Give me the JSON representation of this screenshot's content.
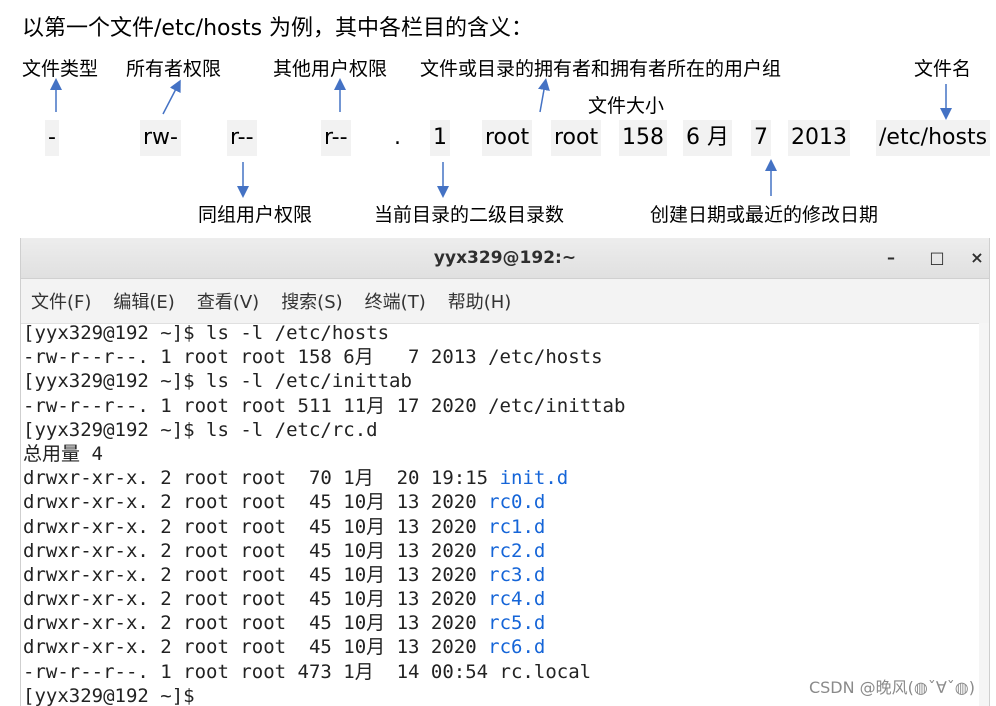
{
  "heading": "以第一个文件/etc/hosts 为例，其中各栏目的含义：",
  "top_labels": {
    "file_type": "文件类型",
    "owner_perm": "所有者权限",
    "other_perm": "其他用户权限",
    "owner_and_group": "文件或目录的拥有者和拥有者所在的用户组",
    "file_name": "文件名",
    "file_size": "文件大小"
  },
  "fields": {
    "type": "-",
    "owner": "rw-",
    "group": "r--",
    "other": "r--",
    "dot": ".",
    "links": "1",
    "user": "root",
    "grp": "root",
    "size": "158",
    "month": "6 月",
    "day": "7",
    "year": "2013",
    "name": "/etc/hosts"
  },
  "bottom_labels": {
    "group_perm": "同组用户权限",
    "subdir_count": "当前目录的二级目录数",
    "date": "创建日期或最近的修改日期"
  },
  "terminal": {
    "title": "yyx329@192:~",
    "minimize": "–",
    "maximize": "□",
    "close": "×",
    "menu": [
      "文件(F)",
      "编辑(E)",
      "查看(V)",
      "搜索(S)",
      "终端(T)",
      "帮助(H)"
    ],
    "lines": [
      {
        "text": "[yyx329@192 ~]$ ls -l /etc/hosts"
      },
      {
        "text": "-rw-r--r--. 1 root root 158 6月   7 2013 /etc/hosts"
      },
      {
        "text": "[yyx329@192 ~]$ ls -l /etc/inittab"
      },
      {
        "text": "-rw-r--r--. 1 root root 511 11月 17 2020 /etc/inittab"
      },
      {
        "text": "[yyx329@192 ~]$ ls -l /etc/rc.d"
      },
      {
        "text": "总用量 4"
      },
      {
        "text": "drwxr-xr-x. 2 root root  70 1月  20 19:15 ",
        "link": "init.d"
      },
      {
        "text": "drwxr-xr-x. 2 root root  45 10月 13 2020 ",
        "link": "rc0.d"
      },
      {
        "text": "drwxr-xr-x. 2 root root  45 10月 13 2020 ",
        "link": "rc1.d"
      },
      {
        "text": "drwxr-xr-x. 2 root root  45 10月 13 2020 ",
        "link": "rc2.d"
      },
      {
        "text": "drwxr-xr-x. 2 root root  45 10月 13 2020 ",
        "link": "rc3.d"
      },
      {
        "text": "drwxr-xr-x. 2 root root  45 10月 13 2020 ",
        "link": "rc4.d"
      },
      {
        "text": "drwxr-xr-x. 2 root root  45 10月 13 2020 ",
        "link": "rc5.d"
      },
      {
        "text": "drwxr-xr-x. 2 root root  45 10月 13 2020 ",
        "link": "rc6.d"
      },
      {
        "text": "-rw-r--r--. 1 root root 473 1月  14 00:54 rc.local"
      },
      {
        "text": "[yyx329@192 ~]$ "
      }
    ],
    "link_color": "#1565d8"
  },
  "watermark": "CSDN @晚风(◍ˇ∀ˇ◍)"
}
